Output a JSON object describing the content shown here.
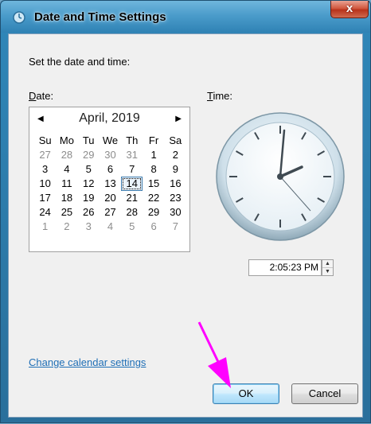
{
  "window": {
    "title": "Date and Time Settings",
    "close_glyph": "x"
  },
  "labels": {
    "prompt": "Set the date and time:",
    "date": "Date:",
    "time": "Time:"
  },
  "calendar": {
    "month_label": "April, 2019",
    "prev_glyph": "◀",
    "next_glyph": "▶",
    "weekdays": [
      "Su",
      "Mo",
      "Tu",
      "We",
      "Th",
      "Fr",
      "Sa"
    ],
    "days": [
      [
        "27",
        "28",
        "29",
        "30",
        "31",
        "1",
        "2"
      ],
      [
        "3",
        "4",
        "5",
        "6",
        "7",
        "8",
        "9"
      ],
      [
        "10",
        "11",
        "12",
        "13",
        "14",
        "15",
        "16"
      ],
      [
        "17",
        "18",
        "19",
        "20",
        "21",
        "22",
        "23"
      ],
      [
        "24",
        "25",
        "26",
        "27",
        "28",
        "29",
        "30"
      ],
      [
        "1",
        "2",
        "3",
        "4",
        "5",
        "6",
        "7"
      ]
    ],
    "selected_day": "14"
  },
  "time": {
    "value": "2:05:23 PM",
    "spin_up": "▲",
    "spin_down": "▼"
  },
  "link": {
    "change_calendar": "Change calendar settings"
  },
  "buttons": {
    "ok": "OK",
    "cancel": "Cancel"
  },
  "colors": {
    "arrow": "#ff00ff",
    "link": "#1f6fb6"
  }
}
